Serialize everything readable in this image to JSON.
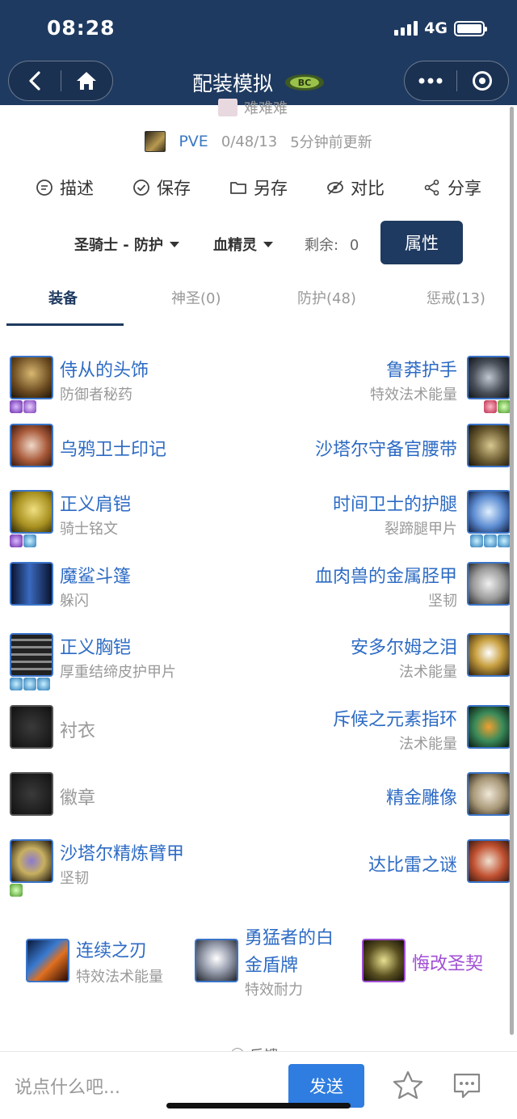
{
  "status_bar": {
    "time": "08:28",
    "network": "4G"
  },
  "nav": {
    "title": "配装模拟",
    "badge_text": "BC"
  },
  "author": {
    "name": "难难难"
  },
  "meta": {
    "mode": "PVE",
    "counts": "0/48/13",
    "updated": "5分钟前更新"
  },
  "actions": [
    {
      "label": "描述",
      "icon": "comment-icon"
    },
    {
      "label": "保存",
      "icon": "check-circle-icon"
    },
    {
      "label": "另存",
      "icon": "folder-icon"
    },
    {
      "label": "对比",
      "icon": "compare-icon"
    },
    {
      "label": "分享",
      "icon": "share-icon"
    }
  ],
  "selectors": {
    "class_spec": "圣骑士 - 防护",
    "race": "血精灵",
    "remaining_label": "剩余:",
    "remaining_value": "0",
    "attributes_button": "属性"
  },
  "tabs": [
    {
      "label": "装备",
      "active": true
    },
    {
      "label": "神圣(0)",
      "active": false
    },
    {
      "label": "防护(48)",
      "active": false
    },
    {
      "label": "惩戒(13)",
      "active": false
    }
  ],
  "equipment_left": [
    {
      "name": "侍从的头饰",
      "enchant": "防御者秘药",
      "gems": [
        "purple",
        "purple"
      ]
    },
    {
      "name": "乌鸦卫士印记",
      "enchant": "",
      "gems": []
    },
    {
      "name": "正义肩铠",
      "enchant": "骑士铭文",
      "gems": [
        "purple",
        "blue"
      ]
    },
    {
      "name": "魔鲨斗篷",
      "enchant": "躲闪",
      "gems": []
    },
    {
      "name": "正义胸铠",
      "enchant": "厚重结缔皮护甲片",
      "gems": [
        "blue",
        "blue",
        "blue"
      ]
    },
    {
      "name": "衬衣",
      "enchant": "",
      "gems": [],
      "empty": true
    },
    {
      "name": "徽章",
      "enchant": "",
      "gems": [],
      "empty": true
    },
    {
      "name": "沙塔尔精炼臂甲",
      "enchant": "坚韧",
      "gems": [
        "green"
      ]
    }
  ],
  "equipment_right": [
    {
      "name": "鲁莽护手",
      "enchant": "特效法术能量",
      "gems": [
        "red",
        "green"
      ]
    },
    {
      "name": "沙塔尔守备官腰带",
      "enchant": "",
      "gems": []
    },
    {
      "name": "时间卫士的护腿",
      "enchant": "裂蹄腿甲片",
      "gems": [
        "blue",
        "blue",
        "blue"
      ]
    },
    {
      "name": "血肉兽的金属胫甲",
      "enchant": "坚韧",
      "gems": []
    },
    {
      "name": "安多尔姆之泪",
      "enchant": "法术能量",
      "gems": []
    },
    {
      "name": "斥候之元素指环",
      "enchant": "法术能量",
      "gems": []
    },
    {
      "name": "精金雕像",
      "enchant": "",
      "gems": []
    },
    {
      "name": "达比雷之谜",
      "enchant": "",
      "gems": []
    }
  ],
  "weapons": [
    {
      "name": "连续之刃",
      "enchant": "特效法术能量"
    },
    {
      "name_line1": "勇猛者的白",
      "name_line2": "金盾牌",
      "enchant": "特效耐力"
    },
    {
      "name": "悔改圣契",
      "enchant": ""
    }
  ],
  "feedback": {
    "label": "反馈"
  },
  "comment": {
    "placeholder": "说点什么吧...",
    "send": "发送"
  },
  "colors": {
    "navy": "#1f3a60",
    "link_blue": "#2d6bc4",
    "epic_purple": "#a14fd4",
    "send_blue": "#2f7de0"
  }
}
